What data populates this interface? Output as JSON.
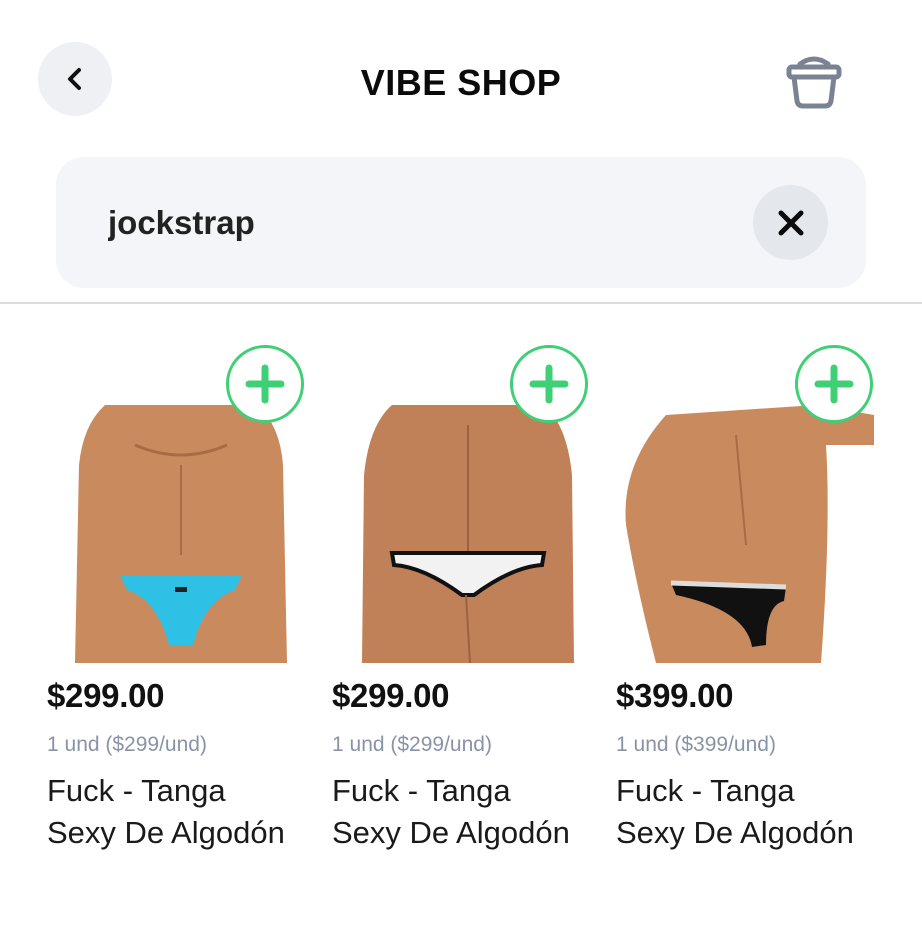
{
  "header": {
    "title": "VIBE SHOP",
    "back_icon": "chevron-left-icon",
    "cart_icon": "basket-icon"
  },
  "search": {
    "value": "jockstrap",
    "clear_icon": "close-icon"
  },
  "colors": {
    "accent_green": "#3fcf74",
    "muted_text": "#8a93a6",
    "search_bg": "#f3f5f8"
  },
  "products": [
    {
      "price": "$299.00",
      "unit": "1 und ($299/und)",
      "name_line1": "Fuck - Tanga",
      "name_line2": "Sexy De Algodón",
      "add_icon": "plus-icon",
      "garment_color": "#2fc0e6"
    },
    {
      "price": "$299.00",
      "unit": "1 und ($299/und)",
      "name_line1": "Fuck - Tanga",
      "name_line2": "Sexy De Algodón",
      "add_icon": "plus-icon",
      "garment_color": "#f2f2f2"
    },
    {
      "price": "$399.00",
      "unit": "1 und ($399/und)",
      "name_line1": "Fuck - Tanga",
      "name_line2": "Sexy De Algodón",
      "add_icon": "plus-icon",
      "garment_color": "#111111"
    }
  ]
}
